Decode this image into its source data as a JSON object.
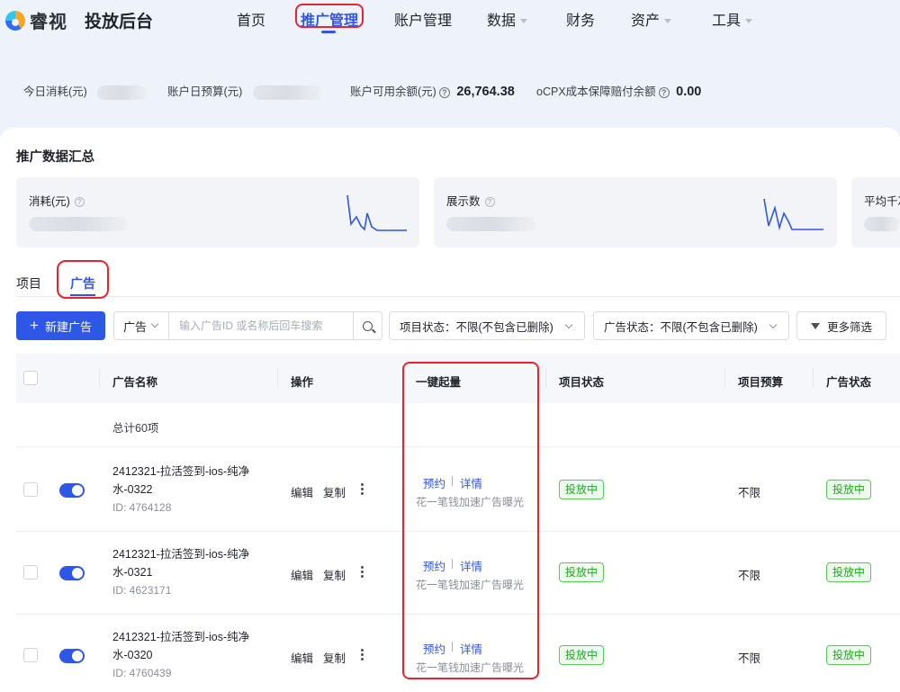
{
  "brand": {
    "logo_text": "睿视",
    "product_title": "投放后台"
  },
  "nav": {
    "items": [
      {
        "label": "首页",
        "has_caret": false
      },
      {
        "label": "推广管理",
        "has_caret": false,
        "active": true
      },
      {
        "label": "账户管理",
        "has_caret": false
      },
      {
        "label": "数据",
        "has_caret": true
      },
      {
        "label": "财务",
        "has_caret": false
      },
      {
        "label": "资产",
        "has_caret": true
      },
      {
        "label": "工具",
        "has_caret": true
      }
    ]
  },
  "balance": {
    "today_cost_label": "今日消耗(元)",
    "daily_budget_label": "账户日预算(元)",
    "available_label": "账户可用余额(元)",
    "available_value": "26,764.38",
    "ocpx_label": "oCPX成本保障赔付余额",
    "ocpx_value": "0.00"
  },
  "summary": {
    "title": "推广数据汇总",
    "cards": [
      {
        "label": "消耗(元)"
      },
      {
        "label": "展示数"
      },
      {
        "label": "平均千次"
      }
    ]
  },
  "tabs": [
    {
      "label": "项目"
    },
    {
      "label": "广告",
      "active": true
    }
  ],
  "toolbar": {
    "new_ad_label": "新建广告",
    "search_scope": "广告",
    "search_placeholder": "输入广告ID 或名称后回车搜索",
    "project_status_filter": "项目状态：不限(不包含已删除)",
    "ad_status_filter": "广告状态：不限(不包含已删除)",
    "more_filters_label": "更多筛选"
  },
  "table": {
    "columns": {
      "ad_name": "广告名称",
      "actions": "操作",
      "one_click_boost": "一键起量",
      "project_status": "项目状态",
      "project_budget": "项目预算",
      "ad_status": "广告状态"
    },
    "total_text": "总计60项",
    "rows": [
      {
        "name": "2412321-拉活签到-ios-纯净水-0322",
        "id": "ID: 4764128",
        "edit": "编辑",
        "copy": "复制",
        "reserve": "预约",
        "detail": "详情",
        "boost_desc": "花一笔钱加速广告曝光",
        "project_status": "投放中",
        "project_budget": "不限",
        "ad_status": "投放中",
        "enabled": true
      },
      {
        "name": "2412321-拉活签到-ios-纯净水-0321",
        "id": "ID: 4623171",
        "edit": "编辑",
        "copy": "复制",
        "reserve": "预约",
        "detail": "详情",
        "boost_desc": "花一笔钱加速广告曝光",
        "project_status": "投放中",
        "project_budget": "不限",
        "ad_status": "投放中",
        "enabled": true
      },
      {
        "name": "2412321-拉活签到-ios-纯净水-0320",
        "id": "ID: 4760439",
        "edit": "编辑",
        "copy": "复制",
        "reserve": "预约",
        "detail": "详情",
        "boost_desc": "花一笔钱加速广告曝光",
        "project_status": "投放中",
        "project_budget": "不限",
        "ad_status": "投放中",
        "enabled": true
      }
    ]
  },
  "colors": {
    "accent": "#2f57e6",
    "highlight": "#e8252e",
    "running": "#22a722"
  }
}
